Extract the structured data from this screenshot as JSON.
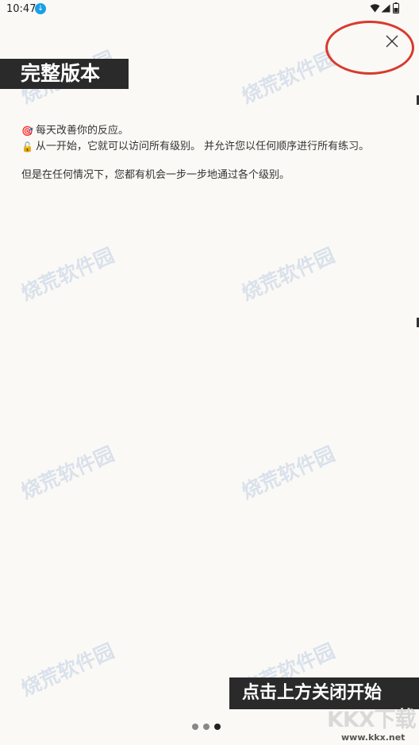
{
  "status_bar": {
    "time": "10:47"
  },
  "banners": {
    "top": "完整版本",
    "bottom": "点击上方关闭开始"
  },
  "content": {
    "line1": "每天改善你的反应。",
    "line2": "从一开始，它就可以访问所有级别。 并允许您以任何顺序进行所有练习。",
    "line3": "但是在任何情况下，您都有机会一步一步地通过各个级别。"
  },
  "watermark_text": "烧荒软件园",
  "corner_logo": {
    "text": "KKX下载",
    "url": "www.kkx.net"
  },
  "pagination": {
    "count": 3,
    "active_index": 2
  },
  "colors": {
    "background": "#fbf9f5",
    "banner": "#2a2a2a",
    "highlight": "#d83a2e",
    "download_badge": "#1aa0e6"
  },
  "icons": {
    "close": "close-x-icon",
    "target": "target-icon",
    "unlock": "unlock-icon"
  }
}
